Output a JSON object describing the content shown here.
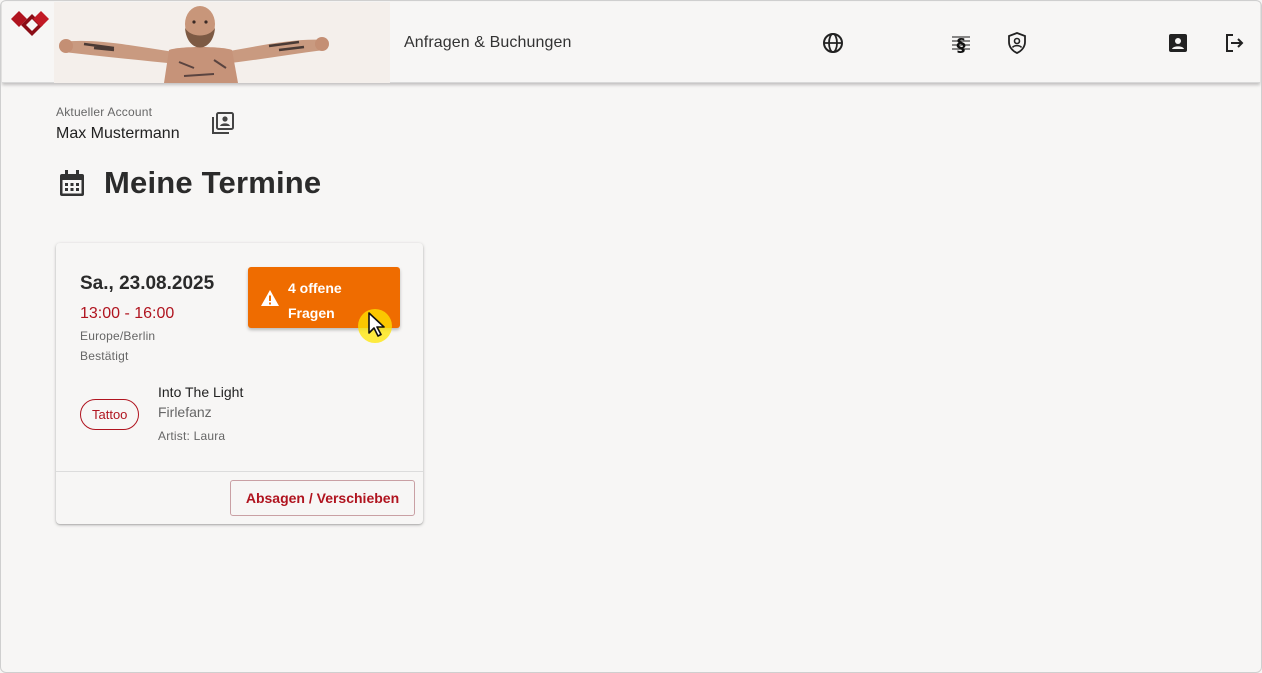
{
  "header": {
    "title": "Anfragen & Buchungen",
    "icons": [
      "globe-icon",
      "paragraph-icon",
      "privacy-shield-icon",
      "account-box-icon",
      "logout-icon"
    ],
    "brand_color": "#b0141f"
  },
  "account": {
    "label": "Aktueller Account",
    "name": "Max Mustermann"
  },
  "page": {
    "title": "Meine Termine"
  },
  "appointments": [
    {
      "date": "Sa., 23.08.2025",
      "time": "13:00 - 16:00",
      "timezone": "Europe/Berlin",
      "status": "Bestätigt",
      "warning_button": "4 offene Fragen",
      "warning_color": "#ef6c00",
      "category_chip": "Tattoo",
      "service_title": "Into The Light",
      "service_subtitle": "Firlefanz",
      "artist": "Artist: Laura",
      "action_button": "Absagen / Verschieben"
    }
  ]
}
